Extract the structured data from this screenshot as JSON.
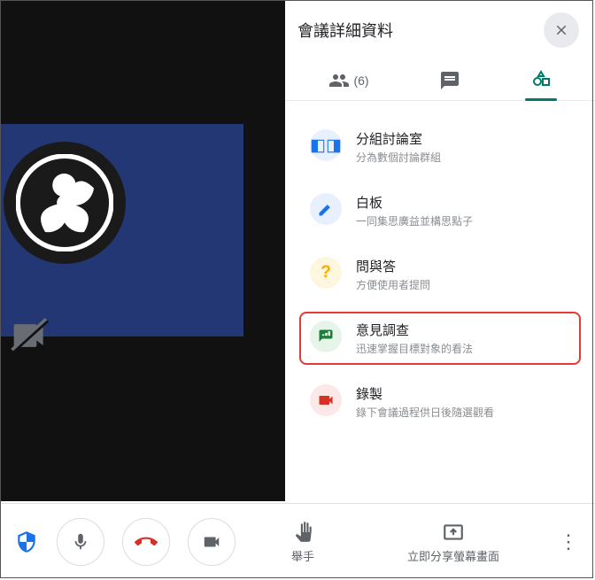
{
  "panel": {
    "title": "會議詳細資料",
    "tabs": {
      "people_count": "(6)"
    }
  },
  "activities": [
    {
      "title": "分組討論室",
      "desc": "分為數個討論群組",
      "icon": "breakout"
    },
    {
      "title": "白板",
      "desc": "一同集思廣益並構思點子",
      "icon": "whiteboard"
    },
    {
      "title": "問與答",
      "desc": "方便使用者提問",
      "icon": "qa"
    },
    {
      "title": "意見調查",
      "desc": "迅速掌握目標對象的看法",
      "icon": "poll",
      "highlight": true
    },
    {
      "title": "錄製",
      "desc": "錄下會議過程供日後隨選觀看",
      "icon": "record"
    }
  ],
  "bottom": {
    "raise_hand": "舉手",
    "present": "立即分享螢幕畫面"
  }
}
